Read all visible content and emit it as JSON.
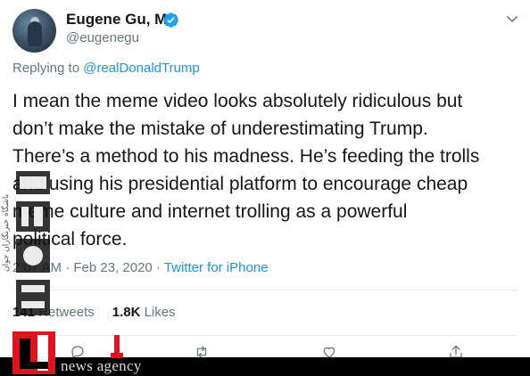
{
  "author": {
    "name": "Eugene Gu, MD",
    "handle": "@eugenegu",
    "verified": true
  },
  "replying_to": {
    "prefix": "Replying to ",
    "mention": "@realDonaldTrump"
  },
  "tweet": {
    "lines": [
      "I mean the meme video looks absolutely ridiculous but",
      "don’t make the mistake of underestimating Trump.",
      "There’s a method to his madness. He’s feeding the trolls",
      "and using his presidential platform to encourage cheap",
      "meme culture and internet trolling as a powerful",
      "political force."
    ],
    "timestamp": "2:07 AM · Feb 23, 2020 · ",
    "source": "Twitter for iPhone"
  },
  "stats": {
    "retweets_count": "141",
    "retweets_label": "Retweets",
    "likes_count": "1.8K",
    "likes_label": "Likes"
  },
  "watermark": {
    "agency": "news agency",
    "vertical_text": "باشگاه خبرنگاران جوان"
  },
  "colors": {
    "link": "#1b95e0",
    "muted": "#657786",
    "text": "#14171a",
    "watermark_red": "#e0141e"
  },
  "icons": [
    "verified-badge-icon",
    "chevron-down-icon",
    "reply-icon",
    "retweet-icon",
    "like-icon",
    "share-icon"
  ]
}
